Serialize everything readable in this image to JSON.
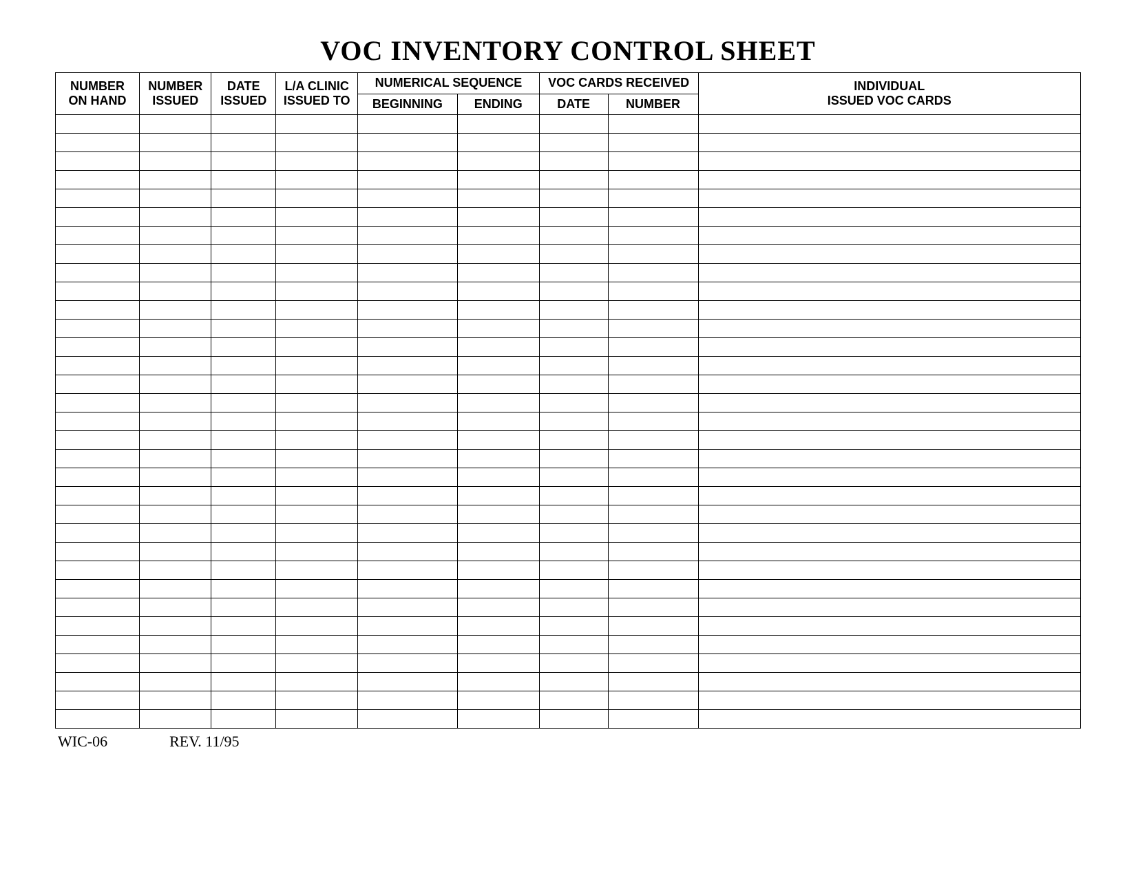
{
  "title": "VOC INVENTORY CONTROL SHEET",
  "headers": {
    "number_on_hand": {
      "line1": "NUMBER",
      "line2": "ON HAND"
    },
    "number_issued": {
      "line1": "NUMBER",
      "line2": "ISSUED"
    },
    "date_issued": {
      "line1": "DATE",
      "line2": "ISSUED"
    },
    "la_clinic": {
      "line1": "L/A CLINIC",
      "line2": "ISSUED TO"
    },
    "numerical_sequence": {
      "group": "NUMERICAL SEQUENCE",
      "beginning": "BEGINNING",
      "ending": "ENDING"
    },
    "voc_cards_received": {
      "group": "VOC CARDS RECEIVED",
      "date": "DATE",
      "number": "NUMBER"
    },
    "individual": {
      "line1": "INDIVIDUAL",
      "line2": "ISSUED VOC CARDS"
    }
  },
  "row_count": 33,
  "footer": {
    "form_id": "WIC-06",
    "revision": "REV. 11/95"
  }
}
